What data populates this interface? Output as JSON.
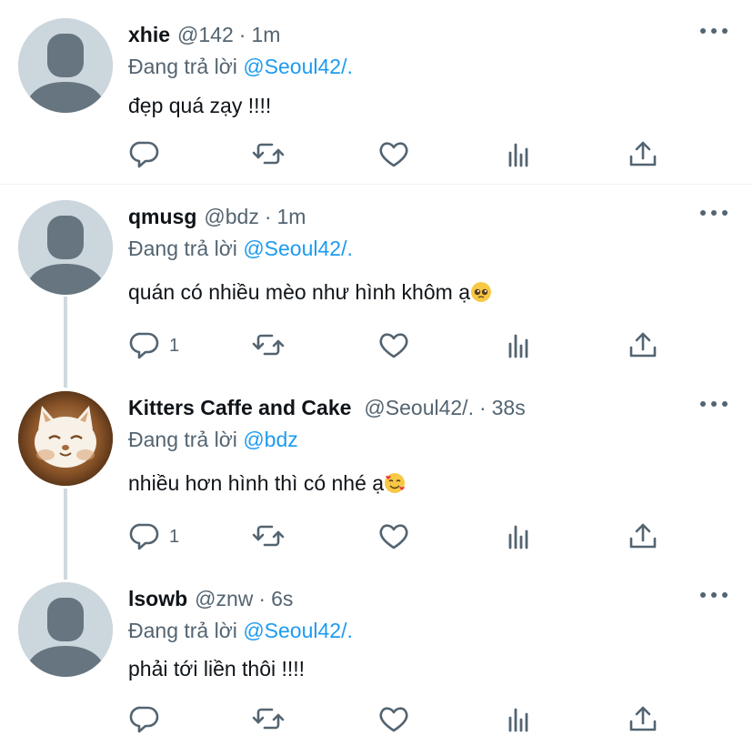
{
  "tweets": [
    {
      "name": "xhie",
      "handle": "@142",
      "time": "1m",
      "reply_prefix": "Đang trả lời",
      "reply_to": "@Seoul42/.",
      "text": "đẹp quá zạy !!!!",
      "reply_count": "",
      "avatar": "default"
    },
    {
      "name": "qmusg",
      "handle": "@bdz",
      "time": "1m",
      "reply_prefix": "Đang trả lời",
      "reply_to": "@Seoul42/.",
      "text": "quán có nhiều mèo như hình khôm ạ",
      "emoji": "pleading-face",
      "reply_count": "1",
      "avatar": "default"
    },
    {
      "name": "Kitters Caffe and Cake",
      "handle": "@Seoul42/.",
      "time": "38s",
      "reply_prefix": "Đang trả lời",
      "reply_to": "@bdz",
      "text": "nhiều hơn hình thì có nhé ạ",
      "emoji": "smiling-face-with-hearts",
      "reply_count": "1",
      "avatar": "latte-art-cat"
    },
    {
      "name": "lsowb",
      "handle": "@znw",
      "time": "6s",
      "reply_prefix": "Đang trả lời",
      "reply_to": "@Seoul42/.",
      "text": "phải tới liền thôi !!!!",
      "reply_count": "",
      "avatar": "default"
    }
  ],
  "separator": "·",
  "icons": [
    "reply-icon",
    "retweet-icon",
    "like-icon",
    "analytics-icon",
    "share-icon",
    "more-icon"
  ],
  "colors": {
    "link": "#1d9bf0",
    "secondary": "#536471",
    "avatar_bg": "#ccd6dd",
    "avatar_fg": "#66757f",
    "thread_line": "#cfd9de"
  }
}
